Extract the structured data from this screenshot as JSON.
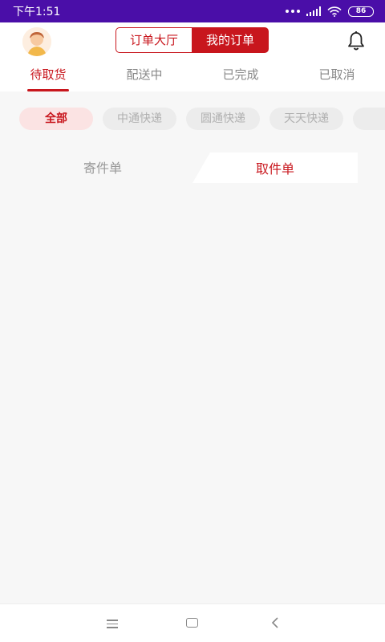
{
  "status_bar": {
    "time": "下午1:51",
    "battery": "86"
  },
  "header": {
    "segment_left": "订单大厅",
    "segment_right": "我的订单"
  },
  "tabs": [
    {
      "label": "待取货",
      "active": true
    },
    {
      "label": "配送中",
      "active": false
    },
    {
      "label": "已完成",
      "active": false
    },
    {
      "label": "已取消",
      "active": false
    }
  ],
  "filters": [
    {
      "label": "全部",
      "active": true
    },
    {
      "label": "中通快递",
      "active": false
    },
    {
      "label": "圆通快递",
      "active": false
    },
    {
      "label": "天天快递",
      "active": false
    }
  ],
  "order_type": {
    "send": "寄件单",
    "pickup": "取件单"
  },
  "colors": {
    "accent": "#c8161d",
    "status_bar": "#4a0ea8"
  },
  "icons": [
    "avatar",
    "bell-icon",
    "wifi-icon",
    "signal-icon",
    "battery-icon",
    "menu-icon",
    "home-icon",
    "back-icon"
  ]
}
